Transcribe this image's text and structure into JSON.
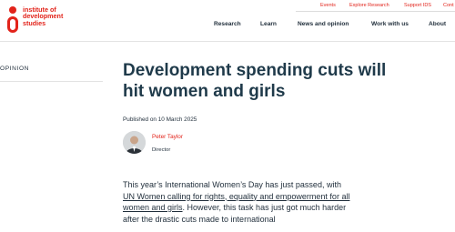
{
  "logo": {
    "line1": "institute of",
    "line2": "development",
    "line3": "studies"
  },
  "utility_nav": [
    "Events",
    "Explore Research",
    "Support IDS",
    "Cont"
  ],
  "main_nav": [
    "Research",
    "Learn",
    "News and opinion",
    "Work with us",
    "About"
  ],
  "sidebar": {
    "label": "OPINION"
  },
  "article": {
    "title": "Development spending cuts will hit women and girls",
    "published": "Published on 10 March 2025",
    "author": {
      "name": "Peter Taylor",
      "role": "Director"
    },
    "body_part1": "This year’s International Women’s Day has just passed, with ",
    "body_link": "UN Women calling for rights, equality and empowerment for all women and girls",
    "body_part2": ". However, this task has just got much harder after the drastic cuts made to international"
  },
  "colors": {
    "accent": "#e2231a",
    "text": "#1f2d3a",
    "title": "#1f3a4a"
  }
}
